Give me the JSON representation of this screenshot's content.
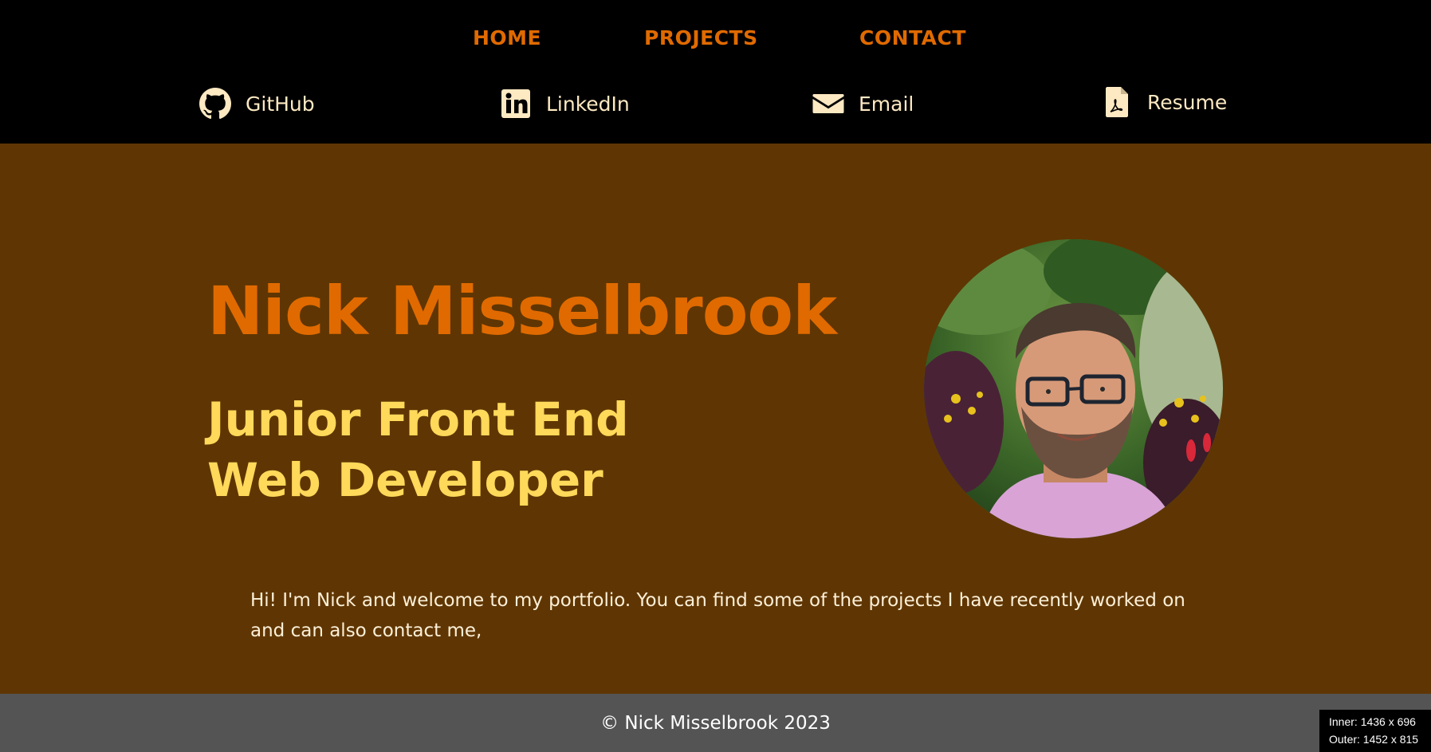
{
  "nav": {
    "home": "HOME",
    "projects": "PROJECTS",
    "contact": "CONTACT"
  },
  "social": {
    "github": {
      "label": "GitHub",
      "icon": "github-icon"
    },
    "linkedin": {
      "label": "LinkedIn",
      "icon": "linkedin-icon"
    },
    "email": {
      "label": "Email",
      "icon": "envelope-icon"
    },
    "resume": {
      "label": "Resume",
      "icon": "pdf-file-icon"
    }
  },
  "hero": {
    "name": "Nick Misselbrook",
    "role_line1": "Junior Front End",
    "role_line2": "Web Developer"
  },
  "intro": "Hi! I'm Nick and welcome to my portfolio. You can find some of the projects I have recently worked on and can also contact me,",
  "footer": {
    "copyright": "© Nick Misselbrook 2023"
  },
  "viewport_info": {
    "inner": "Inner: 1436 x 696",
    "outer": "Outer: 1452 x 815"
  },
  "colors": {
    "header_bg": "#000000",
    "main_bg": "#5f3603",
    "nav_accent": "#e06a00",
    "name_color": "#e06a00",
    "role_color": "#ffd95a",
    "social_text": "#fde9c2",
    "footer_bg": "#545454"
  }
}
